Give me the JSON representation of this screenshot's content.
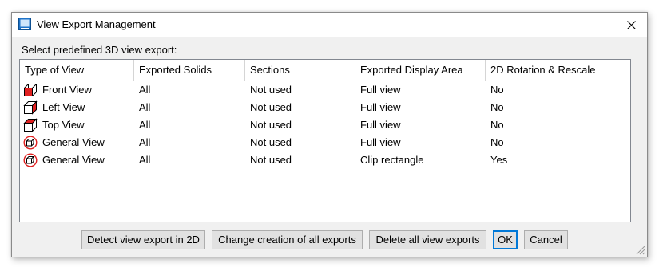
{
  "window": {
    "title": "View Export Management",
    "icon": "app-window-icon",
    "close_icon": "close-icon"
  },
  "prompt": "Select predefined 3D view export:",
  "table": {
    "columns": [
      "Type of View",
      "Exported Solids",
      "Sections",
      "Exported Display Area",
      "2D Rotation & Rescale"
    ],
    "rows": [
      {
        "icon": "front-view-icon",
        "type": "Front View",
        "solids": "All",
        "sections": "Not used",
        "area": "Full view",
        "rotation": "No"
      },
      {
        "icon": "left-view-icon",
        "type": "Left View",
        "solids": "All",
        "sections": "Not used",
        "area": "Full view",
        "rotation": "No"
      },
      {
        "icon": "top-view-icon",
        "type": "Top View",
        "solids": "All",
        "sections": "Not used",
        "area": "Full view",
        "rotation": "No"
      },
      {
        "icon": "general-view-icon",
        "type": "General View",
        "solids": "All",
        "sections": "Not used",
        "area": "Full view",
        "rotation": "No"
      },
      {
        "icon": "general-view-icon",
        "type": "General View",
        "solids": "All",
        "sections": "Not used",
        "area": "Clip rectangle",
        "rotation": "Yes"
      }
    ]
  },
  "buttons": {
    "detect": "Detect view export in 2D",
    "change": "Change creation of all exports",
    "delete": "Delete all view exports",
    "ok": "OK",
    "cancel": "Cancel"
  },
  "colors": {
    "accent": "#0078d7",
    "icon_red": "#e02020"
  }
}
